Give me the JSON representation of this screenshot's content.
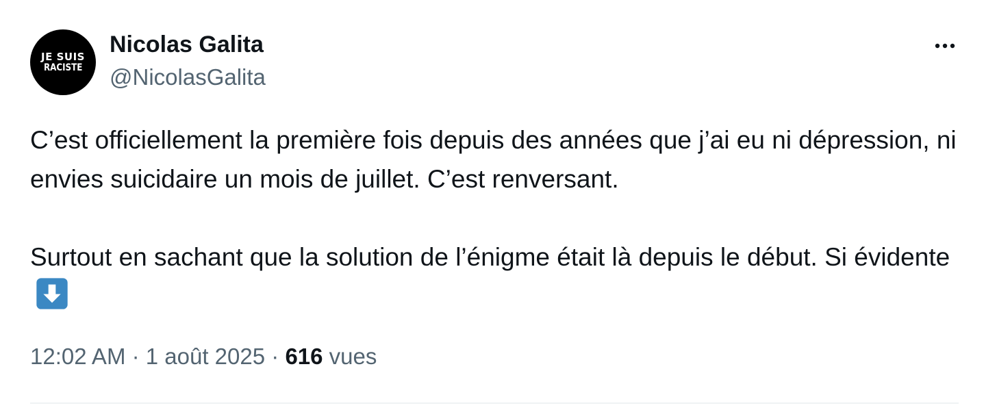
{
  "author": {
    "avatar_line1": "JE SUIS",
    "avatar_line2": "RACISTE",
    "name": "Nicolas Galita",
    "handle": "@NicolasGalita"
  },
  "tweet": {
    "paragraph1": "C’est officiellement la première fois depuis des années que j’ai eu ni dépression, ni envies suicidaire un mois de juillet. C’est renversant.",
    "paragraph2": "Surtout en sachant que la solution de l’énigme était là depuis le début. Si évidente",
    "emoji_icon": "down-arrow-emoji-icon"
  },
  "meta": {
    "time": "12:02 AM",
    "separator": " · ",
    "date": "1 août 2025",
    "views_count": "616",
    "views_label": "vues"
  },
  "colors": {
    "text_primary": "#0f1419",
    "text_secondary": "#536471",
    "emoji_blue": "#3b88c3",
    "divider": "#eff3f4"
  },
  "icons": {
    "more": "more-options-icon"
  }
}
